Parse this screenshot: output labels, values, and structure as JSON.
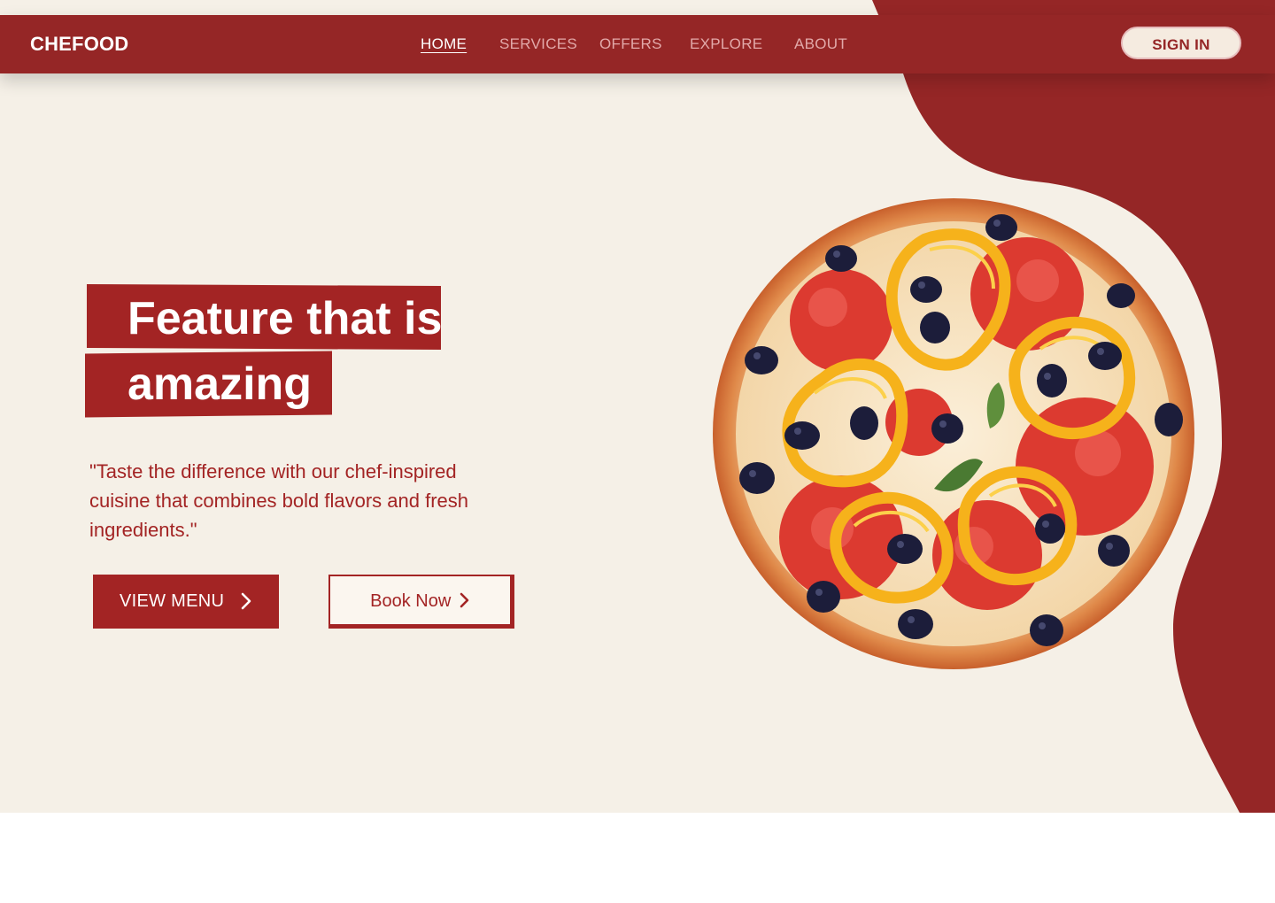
{
  "brand": {
    "name": "CHEFOOD"
  },
  "nav": {
    "links": [
      "HOME",
      "SERVICES",
      "OFFERS",
      "EXPLORE",
      "ABOUT"
    ],
    "active": "HOME",
    "signin_label": "SIGN IN"
  },
  "hero": {
    "title_line1": "Feature that is",
    "title_line2": "amazing",
    "quote": "\"Taste the difference with our chef-inspired cuisine that combines bold flavors and fresh ingredients.\"",
    "view_menu_label": "VIEW MENU",
    "book_now_label": "Book Now",
    "image": "pizza-image"
  },
  "colors": {
    "primary": "#952626",
    "accent": "#a32424",
    "background": "#f5f0e7",
    "pepper": "#f4b21c",
    "tomato": "#d8312b",
    "olive": "#1c1d3a"
  }
}
